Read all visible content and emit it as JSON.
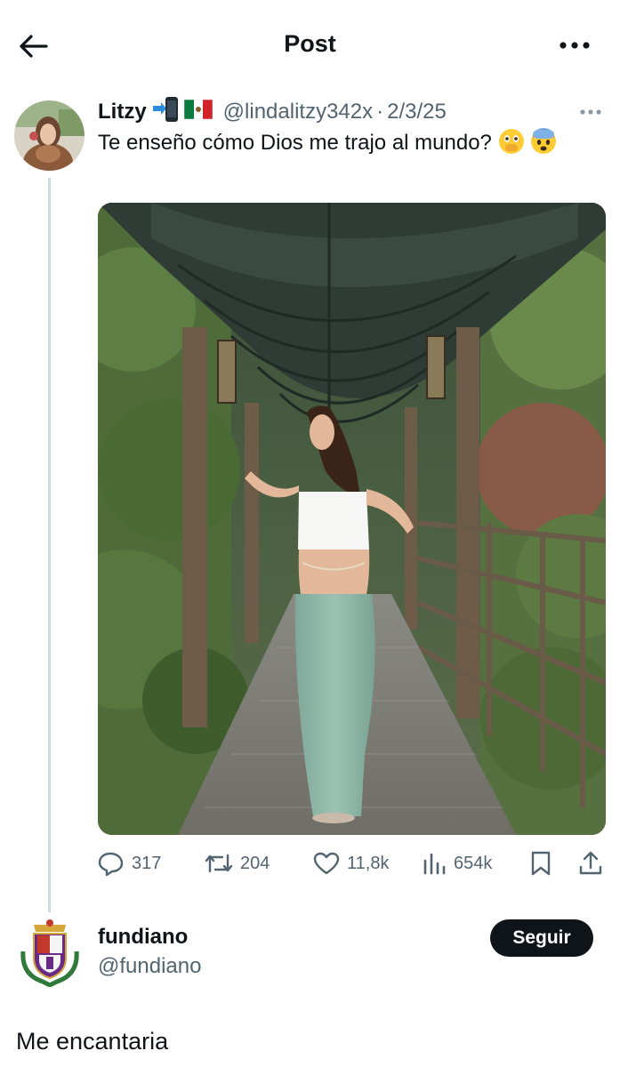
{
  "header": {
    "title": "Post",
    "back_icon": "arrow-left-icon",
    "more_icon": "ellipsis-icon"
  },
  "quoted_post": {
    "author_name": "Litzy",
    "author_name_emojis": [
      "mobile-arrow-emoji",
      "mexico-flag-emoji"
    ],
    "handle": "@lindalitzy342x",
    "separator": "·",
    "date": "2/3/25",
    "text": "Te enseño cómo Dios me trajo al mundo?",
    "text_emojis": [
      "face-with-open-eyes-and-hand-over-mouth-emoji",
      "anxious-face-emoji"
    ],
    "image": "photo-woman-in-garden-walkway",
    "stats": {
      "replies": "317",
      "reposts": "204",
      "likes": "11,8k",
      "views": "654k"
    }
  },
  "reply": {
    "author_name": "fundiano",
    "handle": "@fundiano",
    "follow_label": "Seguir",
    "text": "Me encantaria"
  },
  "colors": {
    "text_primary": "#0f1419",
    "text_secondary": "#536471",
    "thread_line": "#cfd9de",
    "follow_bg": "#0f1419",
    "follow_text": "#ffffff"
  }
}
